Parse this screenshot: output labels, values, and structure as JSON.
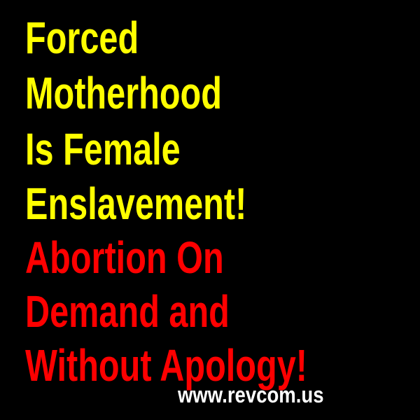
{
  "colors": {
    "background": "#000000",
    "headline": "#ffff00",
    "demand": "#ff0000",
    "url": "#ffffff"
  },
  "headline_lines": [
    "Forced",
    "Motherhood",
    "Is Female",
    "Enslavement!"
  ],
  "demand_lines": [
    "Abortion On",
    "Demand and",
    "Without Apology!"
  ],
  "website": "www.revcom.us"
}
